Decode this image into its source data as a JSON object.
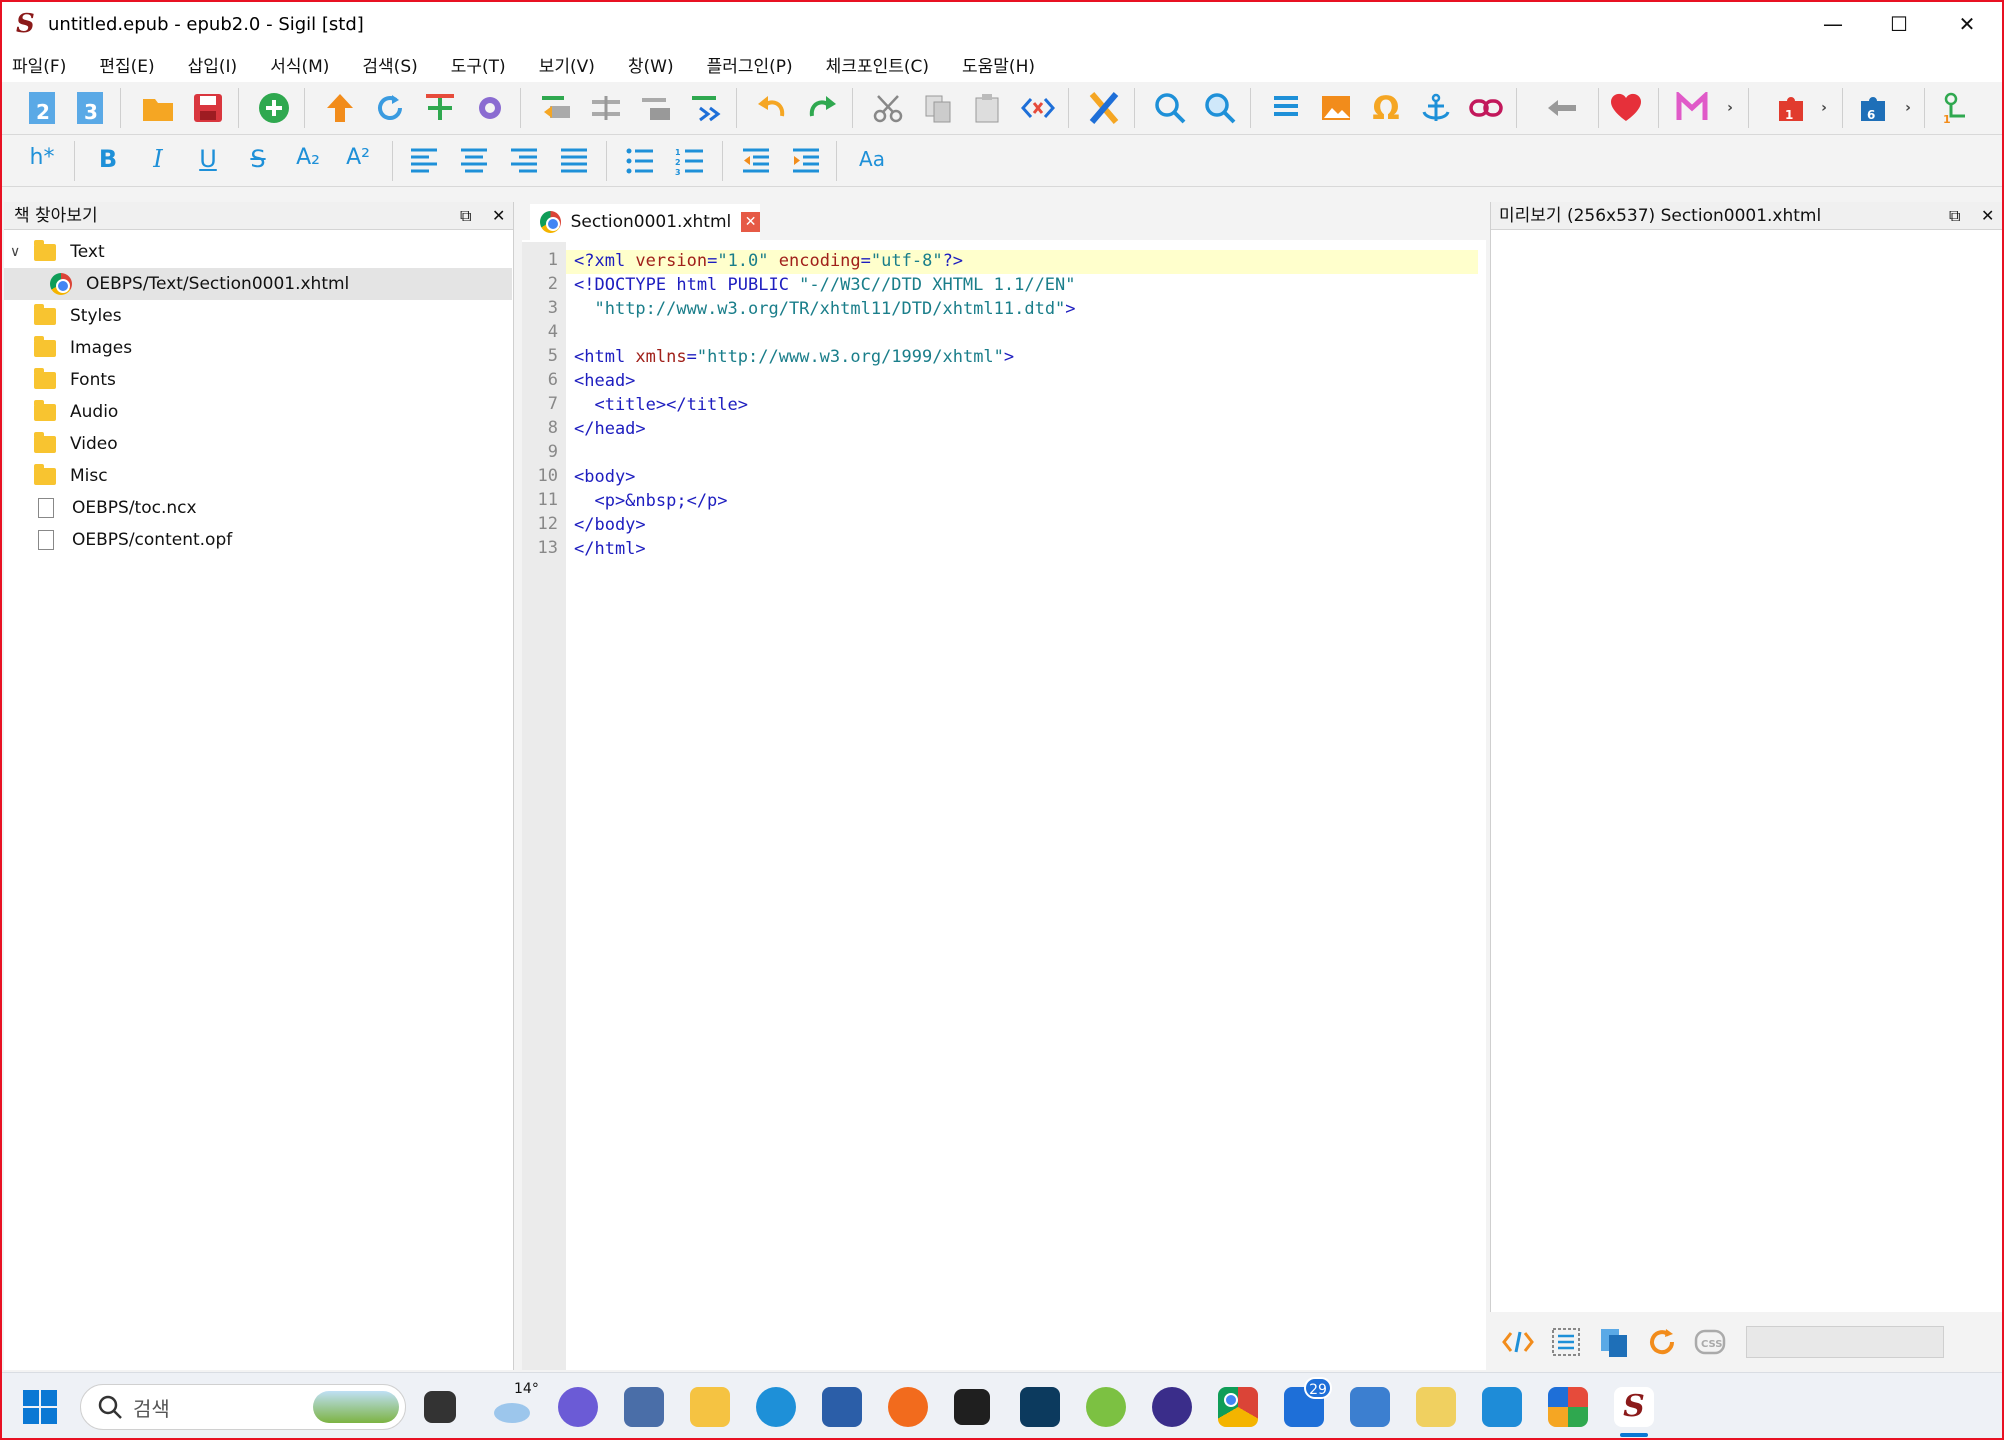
{
  "window": {
    "title": "untitled.epub - epub2.0 - Sigil [std]",
    "minimize": "—",
    "maximize": "☐",
    "close": "✕"
  },
  "menu": [
    "파일(F)",
    "편집(E)",
    "삽입(I)",
    "서식(M)",
    "검색(S)",
    "도구(T)",
    "보기(V)",
    "창(W)",
    "플러그인(P)",
    "체크포인트(C)",
    "도움말(H)"
  ],
  "format_toolbar": {
    "heading": "h*",
    "bold": "B",
    "italic": "I",
    "underline": "U",
    "strike": "S",
    "subscript": "A₂",
    "superscript": "A²",
    "case": "Aa"
  },
  "book_browser": {
    "title": "책 찾아보기",
    "items": [
      {
        "label": "Text",
        "kind": "folder"
      },
      {
        "label": "OEBPS/Text/Section0001.xhtml",
        "kind": "xhtml"
      },
      {
        "label": "Styles",
        "kind": "folder"
      },
      {
        "label": "Images",
        "kind": "folder"
      },
      {
        "label": "Fonts",
        "kind": "folder"
      },
      {
        "label": "Audio",
        "kind": "folder"
      },
      {
        "label": "Video",
        "kind": "folder"
      },
      {
        "label": "Misc",
        "kind": "folder"
      },
      {
        "label": "OEBPS/toc.ncx",
        "kind": "file"
      },
      {
        "label": "OEBPS/content.opf",
        "kind": "file"
      }
    ]
  },
  "editor": {
    "tab_label": "Section0001.xhtml",
    "tab_close": "✕",
    "lines": [
      "<?xml version=\"1.0\" encoding=\"utf-8\"?>",
      "<!DOCTYPE html PUBLIC \"-//W3C//DTD XHTML 1.1//EN\"",
      "  \"http://www.w3.org/TR/xhtml11/DTD/xhtml11.dtd\">",
      "",
      "<html xmlns=\"http://www.w3.org/1999/xhtml\">",
      "<head>",
      "  <title></title>",
      "</head>",
      "",
      "<body>",
      "  <p>&nbsp;</p>",
      "</body>",
      "</html>"
    ]
  },
  "preview": {
    "title": "미리보기 (256x537) Section0001.xhtml"
  },
  "taskbar": {
    "search_placeholder": "검색",
    "weather_temp": "14°",
    "mail_badge": "29"
  },
  "colors": {
    "accent_blue": "#1e90d8",
    "border_red": "#e81123",
    "current_line": "#ffffcc"
  }
}
